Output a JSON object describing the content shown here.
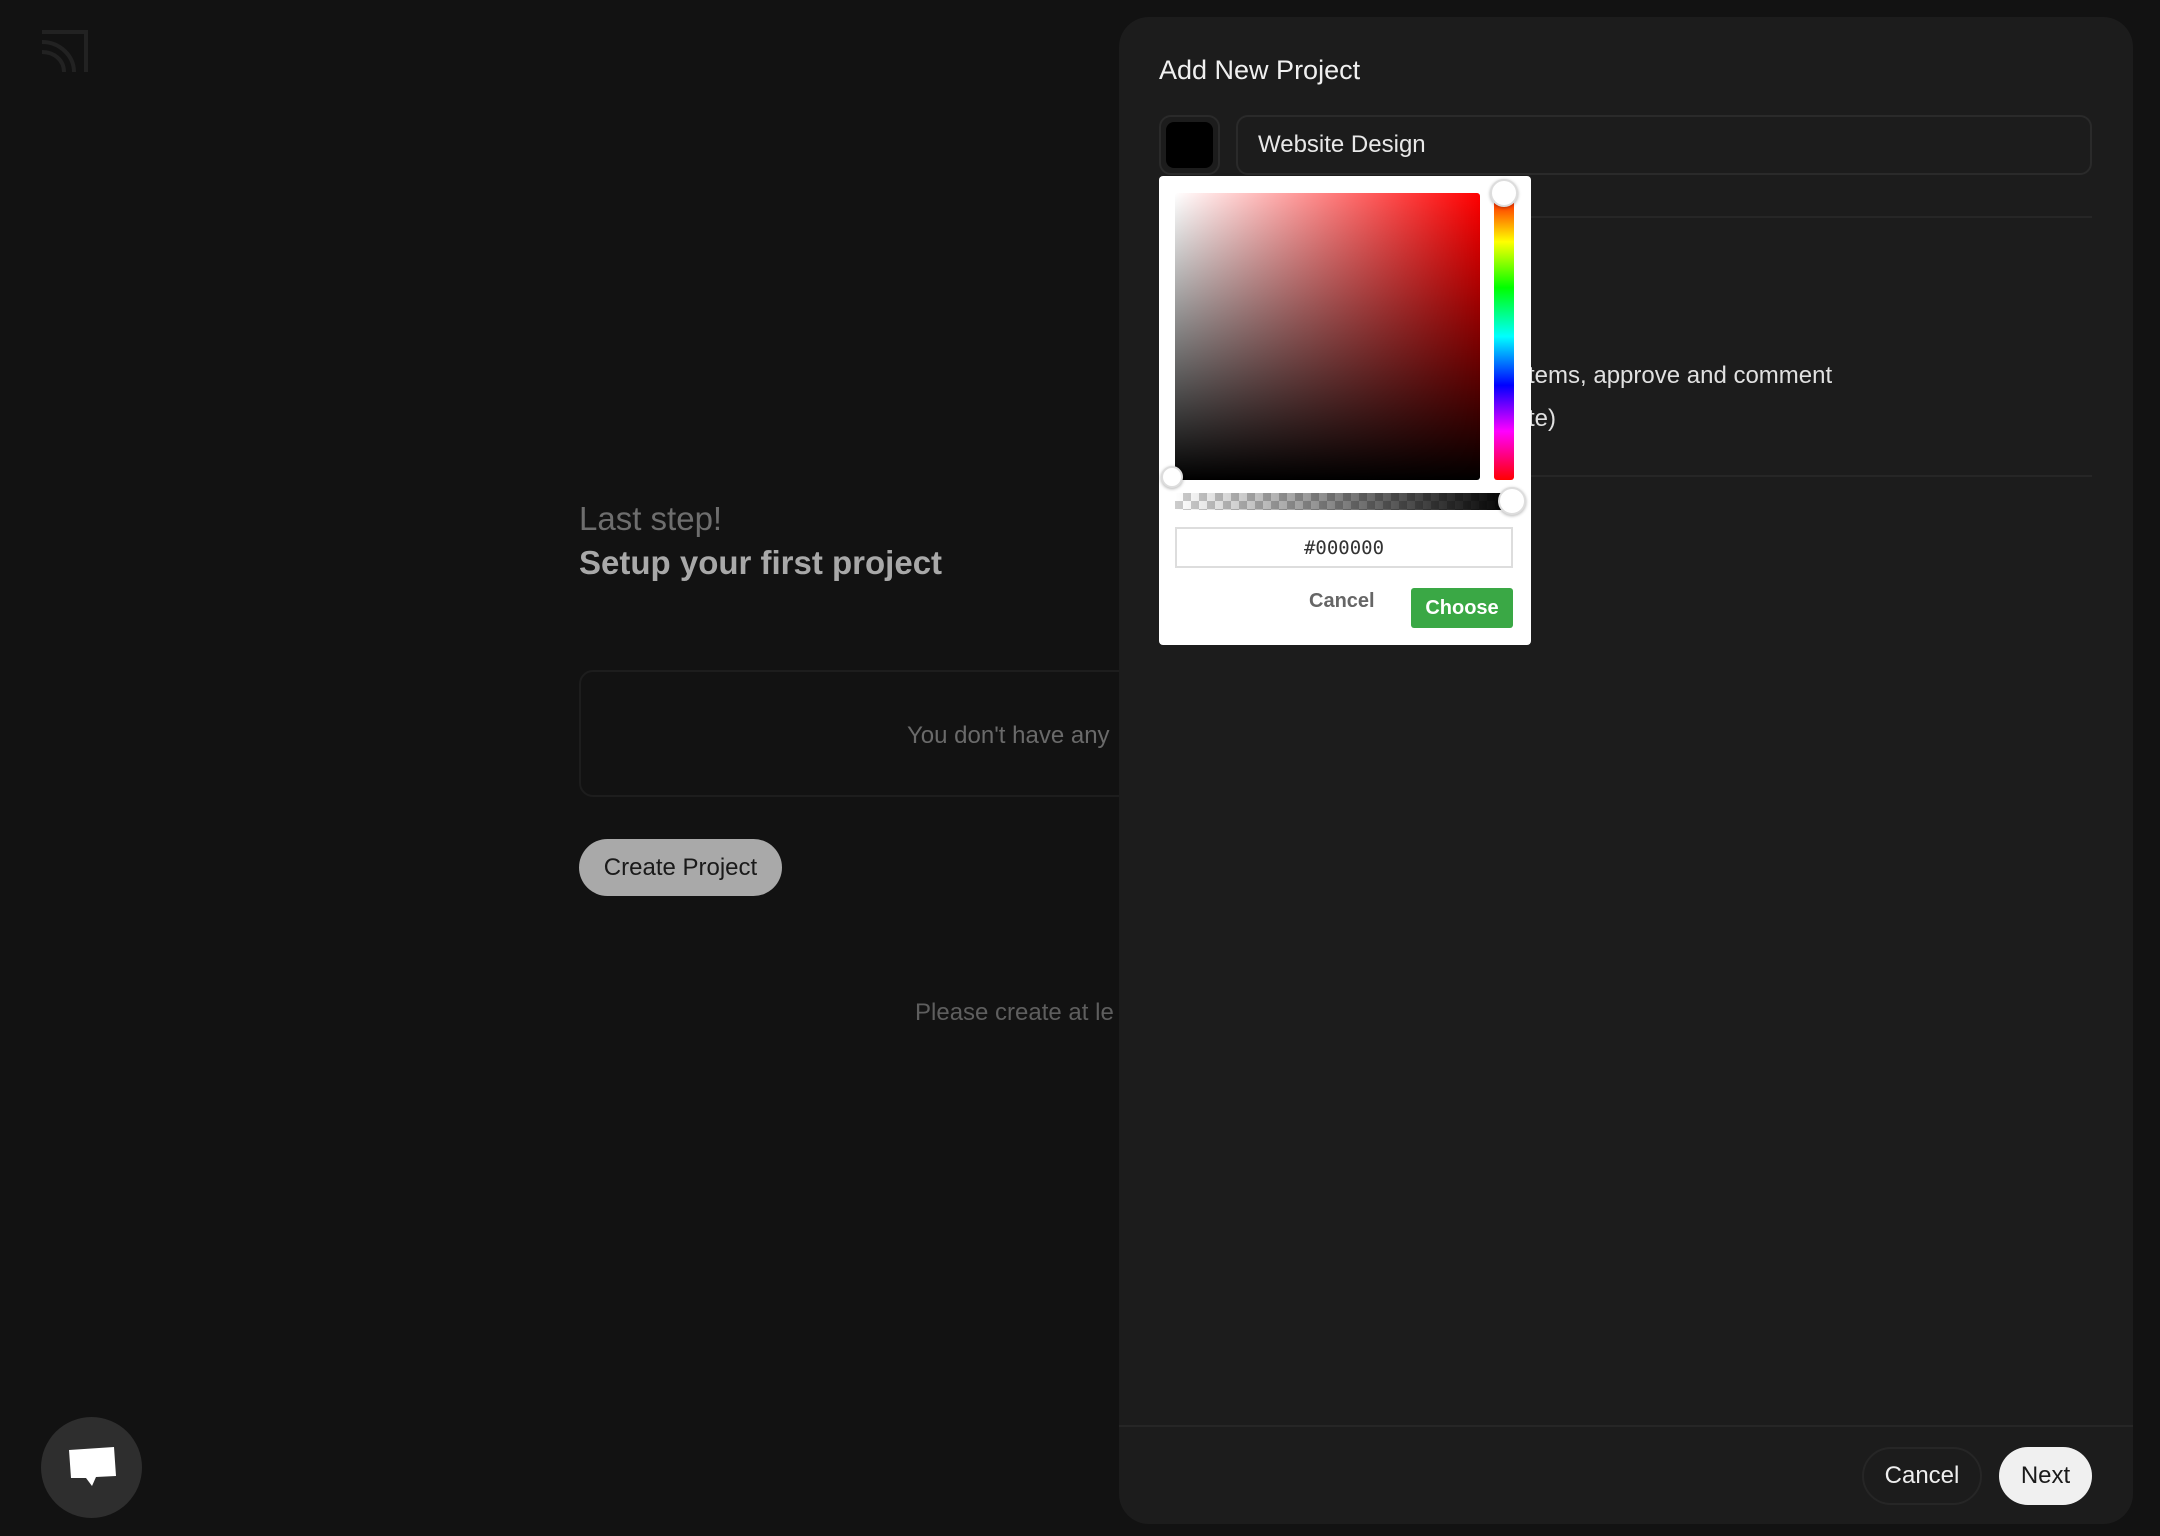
{
  "background": {
    "heading_small": "Last step!",
    "heading": "Setup your first project",
    "empty_text": "You don't have any",
    "create_button": "Create Project",
    "hint_text": "Please create at le"
  },
  "panel": {
    "title": "Add New Project",
    "swatch_color": "#000000",
    "name_value": "Website Design",
    "option_line_1": "tems, approve and comment",
    "option_line_2": "te)",
    "cancel": "Cancel",
    "next": "Next"
  },
  "color_picker": {
    "hue_color": "#ff0000",
    "hex_value": "#000000",
    "alpha_percent": 100,
    "cancel": "Cancel",
    "choose": "Choose",
    "choose_color": "#3aa845"
  }
}
